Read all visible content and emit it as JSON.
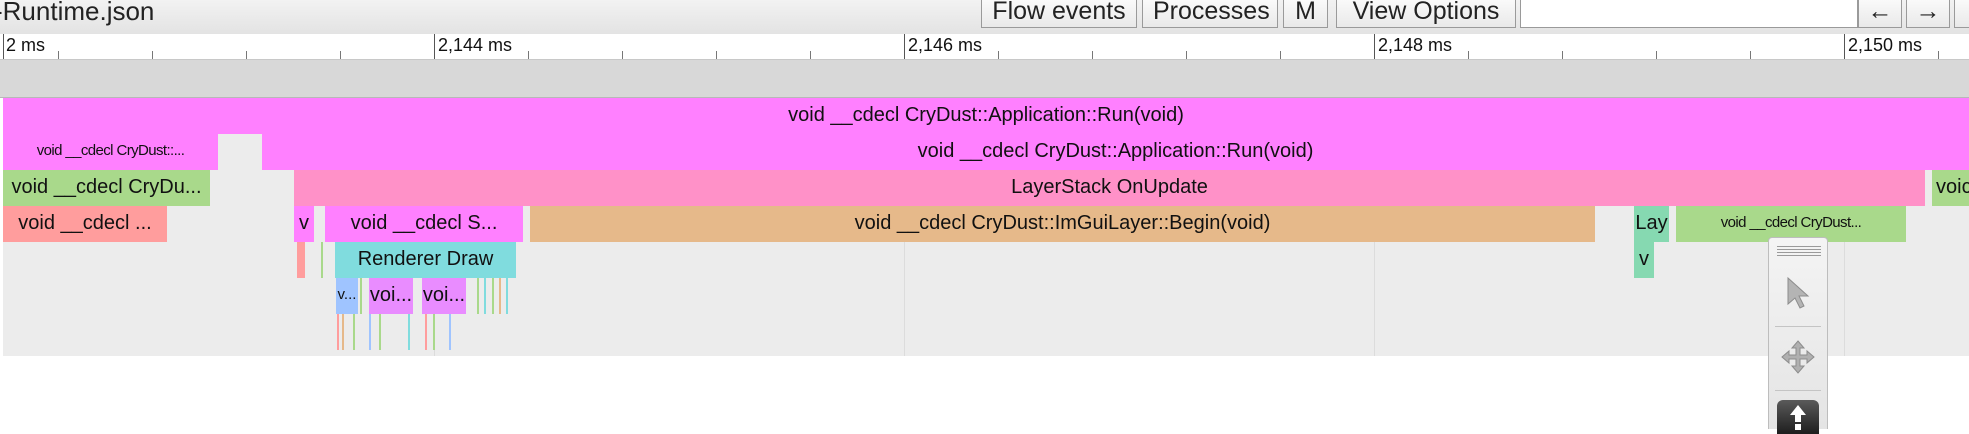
{
  "header": {
    "title": "-Runtime.json",
    "buttons": {
      "flow_events": "Flow events",
      "processes": "Processes",
      "m": "M",
      "view_options": "View Options"
    },
    "nav": {
      "back": "←",
      "forward": "→"
    }
  },
  "ruler": {
    "labels": [
      "2 ms",
      "2,144 ms",
      "2,146 ms",
      "2,148 ms",
      "2,150 ms"
    ]
  },
  "slices": {
    "run_top": "void __cdecl CryDust::Application::Run(void)",
    "run_small": "void __cdecl CryDust::...",
    "run_main": "void __cdecl CryDust::Application::Run(void)",
    "crydu": "void __cdecl CryDu...",
    "layerstack": "LayerStack OnUpdate",
    "void_right": "voic",
    "void_cdecl": "void __cdecl ...",
    "v1": "v",
    "void_s": "void __cdecl S...",
    "imgui_begin": "void __cdecl CryDust::ImGuiLayer::Begin(void)",
    "lay": "Lay",
    "crydust_small2": "void __cdecl CryDust...",
    "renderer_draw": "Renderer Draw",
    "v2": "v",
    "v_dots": "v...",
    "voi1": "voi...",
    "voi2": "voi..."
  },
  "colors": {
    "magenta": "#ff80ff",
    "pink": "#ff91c8",
    "green": "#a9d98b",
    "salmon": "#ff9d9d",
    "tan": "#e6b98a",
    "cyan": "#80dcde",
    "mint": "#86d9b1",
    "violet": "#e98cff",
    "blue": "#9fc4ff"
  },
  "toolbox": {
    "tools": [
      "pointer-tool",
      "pan-tool",
      "zoom-tool"
    ]
  }
}
